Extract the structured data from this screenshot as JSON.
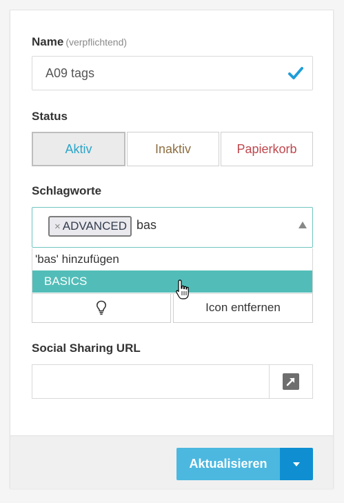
{
  "form": {
    "name": {
      "label": "Name",
      "hint": "(verpflichtend)",
      "value": "A09 tags"
    },
    "status": {
      "label": "Status",
      "options": [
        "Aktiv",
        "Inaktiv",
        "Papierkorb"
      ],
      "selected": "Aktiv"
    },
    "tags": {
      "label": "Schlagworte",
      "chips": [
        {
          "text": "ADVANCED",
          "remove": "×"
        }
      ],
      "typed": "bas",
      "suggestions": [
        "'bas' hinzufügen",
        "BASICS"
      ],
      "highlighted": "BASICS"
    },
    "icon": {
      "remove_label": "Icon entfernen",
      "icon": "lightbulb-icon"
    },
    "social": {
      "label": "Social Sharing URL",
      "value": "",
      "open_icon": "external-link-icon"
    }
  },
  "footer": {
    "submit_label": "Aktualisieren",
    "dropdown_icon": "caret-down-icon"
  },
  "colors": {
    "active": "#2aa5c9",
    "inactive": "#8d6e40",
    "trash": "#c0474d",
    "highlight": "#52bdb8",
    "primary": "#4cb8e0",
    "primary_dark": "#0f8fd1",
    "check": "#1e9ed8"
  }
}
